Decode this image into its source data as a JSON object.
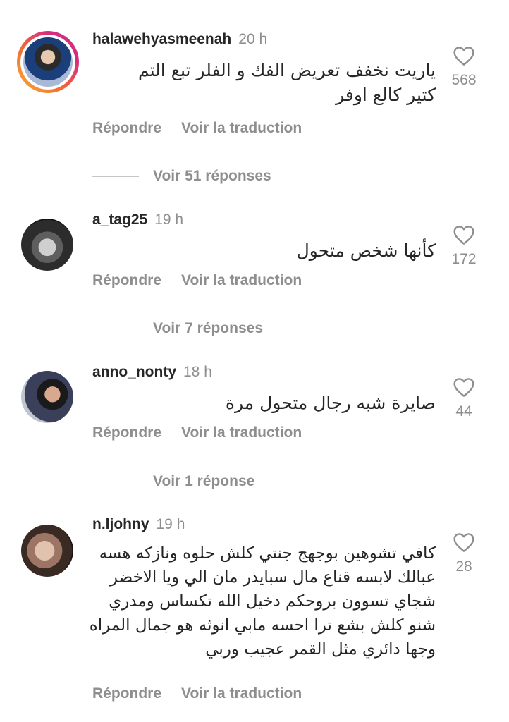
{
  "comments": [
    {
      "username": "halawehyasmeenah",
      "time": "20 h",
      "text": "ياريت نخفف تعريض الفك و الفلر تبع التم كتير كالع اوفر",
      "likes": "568",
      "reply_label": "Répondre",
      "translate_label": "Voir la traduction",
      "view_replies": "Voir 51 réponses"
    },
    {
      "username": "a_tag25",
      "time": "19 h",
      "text": "كأنها شخص متحول",
      "likes": "172",
      "reply_label": "Répondre",
      "translate_label": "Voir la traduction",
      "view_replies": "Voir 7 réponses"
    },
    {
      "username": "anno_nonty",
      "time": "18 h",
      "text": "صايرة شبه رجال متحول مرة",
      "likes": "44",
      "reply_label": "Répondre",
      "translate_label": "Voir la traduction",
      "view_replies": "Voir 1 réponse"
    },
    {
      "username": "n.ljohny",
      "time": "19 h",
      "text": "كافي تشوهين بوجهج جنتي كلش حلوه ونازكه هسه عبالك لابسه قناع مال سبايدر مان الي ويا الاخضر شجاي تسوون بروحكم دخيل الله تكساس ومدري شنو كلش بشع ترا احسه مابي انوثه هو جمال المراه وجها دائري مثل القمر عجيب وربي",
      "likes": "28",
      "reply_label": "Répondre",
      "translate_label": "Voir la traduction"
    }
  ],
  "icons": {
    "avatar_story_ring": "instagram-story-ring",
    "like": "heart-outline-icon"
  },
  "colors": {
    "primary_text": "#262626",
    "secondary_text": "#8e8e8e"
  }
}
